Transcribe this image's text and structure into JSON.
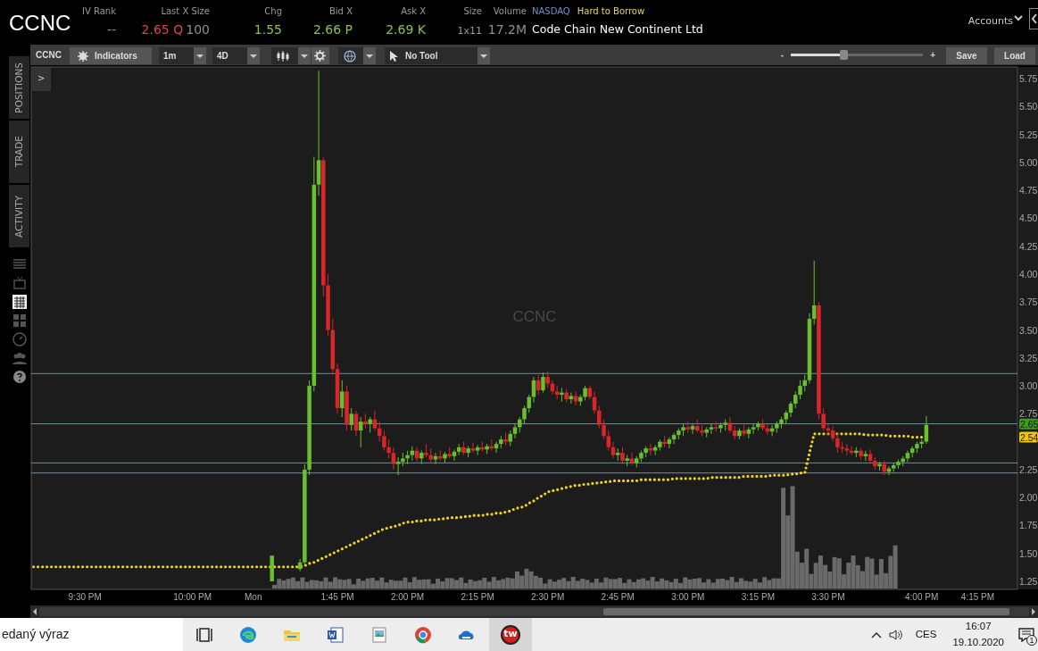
{
  "header": {
    "symbol": "CCNC",
    "quote_fields": [
      {
        "label": "IV Rank",
        "values": [
          {
            "text": "--",
            "color": "#8f8f8f",
            "kind": "normal"
          }
        ]
      },
      {
        "label": "Last X Size",
        "values": [
          {
            "text": "2.65 Q",
            "color": "#e0443c",
            "kind": "normal"
          },
          {
            "text": "100",
            "color": "#8f8f8f",
            "kind": "normal"
          }
        ]
      },
      {
        "label": "Chg",
        "values": [
          {
            "text": "1.55",
            "color": "#8cc152",
            "kind": "normal"
          }
        ]
      },
      {
        "label": "Bid X",
        "values": [
          {
            "text": "2.66 P",
            "color": "#8cc152",
            "kind": "normal"
          }
        ]
      },
      {
        "label": "Ask X",
        "values": [
          {
            "text": "2.69 K",
            "color": "#8cc152",
            "kind": "normal"
          }
        ]
      },
      {
        "label": "Size",
        "values": [
          {
            "text": "1x11",
            "color": "#9a9a9a",
            "kind": "small"
          }
        ]
      },
      {
        "label": "Volume",
        "values": [
          {
            "text": "17.2M",
            "color": "#8f8f8f",
            "kind": "normal"
          }
        ]
      }
    ],
    "exchange": "NASDAQ",
    "borrow_status": "Hard to Borrow",
    "company": "Code Chain New Continent Ltd",
    "accounts": "Accounts"
  },
  "sidebar": {
    "tabs": [
      {
        "label": "POSITIONS",
        "selected": false
      },
      {
        "label": "TRADE",
        "selected": false
      },
      {
        "label": "ACTIVITY",
        "selected": false
      }
    ],
    "icons": [
      {
        "kind": "list",
        "selected": false
      },
      {
        "kind": "tv",
        "selected": false
      },
      {
        "kind": "chart",
        "selected": true
      },
      {
        "kind": "grid",
        "selected": false
      },
      {
        "kind": "gauge",
        "selected": false
      },
      {
        "kind": "people",
        "selected": false
      },
      {
        "kind": "help",
        "selected": false
      }
    ]
  },
  "toolbar": {
    "symbol": "CCNC",
    "indicators": "Indicators",
    "interval": "1m",
    "range": "4D",
    "tool": "No Tool",
    "zoom": {
      "minus": "-",
      "plus": "+",
      "level": 0.4
    },
    "buttons": [
      "Save",
      "Load"
    ]
  },
  "chart": {
    "expand_button": ">",
    "symbol_label": "CCNC",
    "price_badges": [
      {
        "text": "2.65",
        "color": "#3f9a1e"
      },
      {
        "text": "2.54",
        "color": "#f2c40f"
      }
    ],
    "chart_data": {
      "type": "candlestick",
      "ylim": [
        1.178,
        5.854
      ],
      "yticks": [
        1.25,
        {
          "value": 1.5,
          "label": "1.50"
        },
        1.75,
        {
          "value": 2,
          "label": "2.00"
        },
        2.25,
        2.75,
        {
          "value": 3,
          "label": "3.00"
        },
        3.25,
        {
          "value": 3.5,
          "label": "3.50"
        },
        3.75,
        {
          "value": 4,
          "label": "4.00"
        },
        4.25,
        {
          "value": 4.5,
          "label": "4.50"
        },
        4.75,
        {
          "value": 5,
          "label": "5.00"
        },
        5.25,
        {
          "value": 5.5,
          "label": "5.50"
        },
        5.75
      ],
      "categories": [
        null,
        null,
        null,
        null,
        null,
        null,
        null,
        null,
        null,
        null,
        null,
        "9:30 PM",
        null,
        null,
        null,
        null,
        null,
        null,
        null,
        null,
        null,
        null,
        null,
        null,
        null,
        null,
        null,
        null,
        null,
        null,
        null,
        null,
        null,
        null,
        "10:00 PM",
        null,
        null,
        null,
        null,
        null,
        null,
        null,
        null,
        null,
        null,
        null,
        null,
        "Mon",
        null,
        null,
        null,
        null,
        null,
        null,
        null,
        null,
        null,
        null,
        null,
        null,
        null,
        null,
        null,
        null,
        null,
        "1:45 PM",
        null,
        null,
        null,
        null,
        null,
        null,
        null,
        null,
        null,
        null,
        null,
        null,
        null,
        null,
        "2:00 PM",
        null,
        null,
        null,
        null,
        null,
        null,
        null,
        null,
        null,
        null,
        null,
        null,
        null,
        null,
        "2:15 PM",
        null,
        null,
        null,
        null,
        null,
        null,
        null,
        null,
        null,
        null,
        null,
        null,
        null,
        null,
        "2:30 PM",
        null,
        null,
        null,
        null,
        null,
        null,
        null,
        null,
        null,
        null,
        null,
        null,
        null,
        null,
        "2:45 PM",
        null,
        null,
        null,
        null,
        null,
        null,
        null,
        null,
        null,
        null,
        null,
        null,
        null,
        null,
        "3:00 PM",
        null,
        null,
        null,
        null,
        null,
        null,
        null,
        null,
        null,
        null,
        null,
        null,
        null,
        null,
        "3:15 PM",
        null,
        null,
        null,
        null,
        null,
        null,
        null,
        null,
        null,
        null,
        null,
        null,
        null,
        null,
        "3:30 PM",
        null,
        null,
        null,
        null,
        null,
        null,
        null,
        null,
        null,
        null,
        null,
        null,
        null,
        null,
        null,
        null,
        null,
        null,
        null,
        "4:00 PM",
        null,
        null,
        null,
        null,
        null,
        null,
        null,
        null,
        null,
        null,
        null,
        "4:15 PM",
        null,
        null,
        null,
        null,
        null,
        null,
        null,
        null
      ],
      "ohlc": [
        null,
        null,
        null,
        null,
        null,
        null,
        null,
        null,
        null,
        null,
        null,
        null,
        null,
        null,
        null,
        null,
        null,
        null,
        null,
        null,
        null,
        null,
        null,
        null,
        null,
        null,
        null,
        null,
        null,
        null,
        null,
        null,
        null,
        null,
        null,
        null,
        null,
        null,
        null,
        null,
        null,
        null,
        null,
        null,
        null,
        null,
        null,
        null,
        null,
        null,
        null,
        [
          1.25,
          1.48,
          1.25,
          1.48
        ],
        null,
        null,
        null,
        null,
        null,
        [
          1.36,
          1.45,
          1.34,
          1.42
        ],
        [
          1.42,
          2.3,
          1.4,
          2.25
        ],
        [
          2.25,
          3.05,
          2.2,
          3.0
        ],
        [
          3.0,
          5.05,
          2.95,
          4.8
        ],
        [
          4.8,
          5.82,
          4.7,
          5.02
        ],
        [
          5.02,
          5.05,
          3.8,
          3.9
        ],
        [
          3.9,
          4.0,
          3.45,
          3.5
        ],
        [
          3.5,
          3.6,
          3.1,
          3.15
        ],
        [
          3.15,
          3.2,
          2.75,
          2.8
        ],
        [
          2.8,
          3.05,
          2.72,
          2.95
        ],
        [
          2.95,
          3.0,
          2.6,
          2.65
        ],
        [
          2.65,
          2.8,
          2.6,
          2.75
        ],
        [
          2.75,
          2.78,
          2.55,
          2.6
        ],
        [
          2.6,
          2.72,
          2.45,
          2.68
        ],
        [
          2.68,
          2.75,
          2.62,
          2.66
        ],
        [
          2.66,
          2.72,
          2.58,
          2.7
        ],
        [
          2.7,
          2.78,
          2.6,
          2.62
        ],
        [
          2.62,
          2.68,
          2.5,
          2.55
        ],
        [
          2.55,
          2.6,
          2.42,
          2.45
        ],
        [
          2.45,
          2.52,
          2.35,
          2.4
        ],
        [
          2.4,
          2.45,
          2.25,
          2.3
        ],
        [
          2.3,
          2.36,
          2.2,
          2.32
        ],
        [
          2.32,
          2.4,
          2.28,
          2.35
        ],
        [
          2.35,
          2.42,
          2.3,
          2.38
        ],
        [
          2.38,
          2.46,
          2.33,
          2.42
        ],
        [
          2.42,
          2.45,
          2.32,
          2.35
        ],
        [
          2.35,
          2.42,
          2.3,
          2.4
        ],
        [
          2.4,
          2.48,
          2.36,
          2.38
        ],
        [
          2.38,
          2.44,
          2.32,
          2.34
        ],
        [
          2.34,
          2.4,
          2.3,
          2.37
        ],
        [
          2.37,
          2.42,
          2.33,
          2.35
        ],
        [
          2.35,
          2.41,
          2.31,
          2.39
        ],
        [
          2.39,
          2.45,
          2.35,
          2.37
        ],
        [
          2.37,
          2.43,
          2.33,
          2.41
        ],
        [
          2.41,
          2.48,
          2.38,
          2.45
        ],
        [
          2.45,
          2.5,
          2.38,
          2.4
        ],
        [
          2.4,
          2.46,
          2.36,
          2.44
        ],
        [
          2.44,
          2.49,
          2.4,
          2.42
        ],
        [
          2.42,
          2.47,
          2.38,
          2.45
        ],
        [
          2.45,
          2.5,
          2.41,
          2.43
        ],
        [
          2.43,
          2.48,
          2.39,
          2.46
        ],
        [
          2.46,
          2.52,
          2.42,
          2.44
        ],
        [
          2.44,
          2.5,
          2.4,
          2.48
        ],
        [
          2.48,
          2.55,
          2.44,
          2.52
        ],
        [
          2.52,
          2.58,
          2.47,
          2.5
        ],
        [
          2.5,
          2.6,
          2.46,
          2.57
        ],
        [
          2.57,
          2.66,
          2.53,
          2.63
        ],
        [
          2.63,
          2.72,
          2.58,
          2.7
        ],
        [
          2.7,
          2.82,
          2.66,
          2.8
        ],
        [
          2.8,
          2.92,
          2.76,
          2.9
        ],
        [
          2.9,
          3.08,
          2.85,
          3.05
        ],
        [
          3.05,
          3.1,
          2.92,
          2.96
        ],
        [
          2.96,
          3.12,
          2.94,
          3.08
        ],
        [
          3.08,
          3.13,
          2.98,
          3.02
        ],
        [
          3.02,
          3.05,
          2.92,
          2.95
        ],
        [
          2.95,
          3.0,
          2.88,
          2.92
        ],
        [
          2.92,
          2.98,
          2.86,
          2.94
        ],
        [
          2.94,
          2.97,
          2.85,
          2.88
        ],
        [
          2.88,
          2.94,
          2.84,
          2.91
        ],
        [
          2.91,
          2.95,
          2.83,
          2.86
        ],
        [
          2.86,
          2.92,
          2.82,
          2.9
        ],
        [
          2.9,
          3.0,
          2.87,
          2.98
        ],
        [
          2.98,
          3.0,
          2.88,
          2.9
        ],
        [
          2.9,
          2.95,
          2.75,
          2.78
        ],
        [
          2.78,
          2.82,
          2.62,
          2.65
        ],
        [
          2.65,
          2.7,
          2.52,
          2.55
        ],
        [
          2.55,
          2.6,
          2.42,
          2.45
        ],
        [
          2.45,
          2.5,
          2.35,
          2.38
        ],
        [
          2.38,
          2.44,
          2.33,
          2.4
        ],
        [
          2.4,
          2.45,
          2.3,
          2.33
        ],
        [
          2.33,
          2.38,
          2.28,
          2.35
        ],
        [
          2.35,
          2.4,
          2.29,
          2.31
        ],
        [
          2.31,
          2.37,
          2.27,
          2.35
        ],
        [
          2.35,
          2.42,
          2.32,
          2.4
        ],
        [
          2.4,
          2.46,
          2.36,
          2.44
        ],
        [
          2.44,
          2.48,
          2.38,
          2.42
        ],
        [
          2.42,
          2.47,
          2.38,
          2.45
        ],
        [
          2.45,
          2.52,
          2.42,
          2.5
        ],
        [
          2.5,
          2.55,
          2.45,
          2.48
        ],
        [
          2.48,
          2.54,
          2.44,
          2.52
        ],
        [
          2.52,
          2.58,
          2.48,
          2.56
        ],
        [
          2.56,
          2.62,
          2.52,
          2.6
        ],
        [
          2.6,
          2.66,
          2.55,
          2.63
        ],
        [
          2.63,
          2.68,
          2.58,
          2.61
        ],
        [
          2.61,
          2.66,
          2.57,
          2.64
        ],
        [
          2.64,
          2.7,
          2.58,
          2.6
        ],
        [
          2.6,
          2.65,
          2.55,
          2.58
        ],
        [
          2.58,
          2.63,
          2.54,
          2.61
        ],
        [
          2.61,
          2.66,
          2.57,
          2.63
        ],
        [
          2.63,
          2.68,
          2.59,
          2.62
        ],
        [
          2.62,
          2.67,
          2.58,
          2.65
        ],
        [
          2.65,
          2.7,
          2.6,
          2.67
        ],
        [
          2.67,
          2.72,
          2.58,
          2.6
        ],
        [
          2.6,
          2.64,
          2.52,
          2.55
        ],
        [
          2.55,
          2.62,
          2.52,
          2.6
        ],
        [
          2.6,
          2.65,
          2.55,
          2.57
        ],
        [
          2.57,
          2.63,
          2.53,
          2.61
        ],
        [
          2.61,
          2.66,
          2.57,
          2.63
        ],
        [
          2.63,
          2.68,
          2.6,
          2.66
        ],
        [
          2.66,
          2.7,
          2.6,
          2.62
        ],
        [
          2.62,
          2.66,
          2.56,
          2.59
        ],
        [
          2.59,
          2.65,
          2.55,
          2.62
        ],
        [
          2.62,
          2.68,
          2.58,
          2.66
        ],
        [
          2.66,
          2.72,
          2.62,
          2.7
        ],
        [
          2.7,
          2.78,
          2.66,
          2.76
        ],
        [
          2.76,
          2.86,
          2.72,
          2.84
        ],
        [
          2.84,
          2.95,
          2.8,
          2.92
        ],
        [
          2.92,
          3.05,
          2.88,
          3.0
        ],
        [
          3.0,
          3.1,
          2.95,
          3.05
        ],
        [
          3.05,
          3.65,
          3.02,
          3.6
        ],
        [
          3.6,
          4.12,
          3.55,
          3.72
        ],
        [
          3.72,
          3.75,
          2.7,
          2.75
        ],
        [
          2.75,
          2.8,
          2.6,
          2.62
        ],
        [
          2.62,
          2.66,
          2.55,
          2.6
        ],
        [
          2.6,
          2.64,
          2.5,
          2.53
        ],
        [
          2.53,
          2.58,
          2.4,
          2.45
        ],
        [
          2.45,
          2.5,
          2.4,
          2.44
        ],
        [
          2.44,
          2.48,
          2.38,
          2.42
        ],
        [
          2.42,
          2.46,
          2.38,
          2.4
        ],
        [
          2.4,
          2.45,
          2.36,
          2.42
        ],
        [
          2.42,
          2.44,
          2.34,
          2.37
        ],
        [
          2.37,
          2.42,
          2.33,
          2.39
        ],
        [
          2.39,
          2.43,
          2.3,
          2.33
        ],
        [
          2.33,
          2.36,
          2.25,
          2.28
        ],
        [
          2.28,
          2.32,
          2.24,
          2.3
        ],
        [
          2.3,
          2.33,
          2.2,
          2.23
        ],
        [
          2.23,
          2.28,
          2.2,
          2.26
        ],
        [
          2.26,
          2.31,
          2.23,
          2.29
        ],
        [
          2.29,
          2.34,
          2.26,
          2.32
        ],
        [
          2.32,
          2.37,
          2.28,
          2.35
        ],
        [
          2.35,
          2.42,
          2.32,
          2.4
        ],
        [
          2.4,
          2.46,
          2.36,
          2.44
        ],
        [
          2.44,
          2.5,
          2.4,
          2.48
        ],
        [
          2.48,
          2.52,
          2.44,
          2.5
        ],
        [
          2.5,
          2.73,
          2.48,
          2.65
        ],
        null,
        null,
        null,
        null,
        null,
        null,
        null,
        null,
        null,
        null,
        null,
        null,
        null,
        null,
        null,
        null,
        null,
        null,
        null
      ],
      "series": [
        {
          "type": "line",
          "color": "#f2d51b",
          "line_style": "dotted",
          "values": [
            1.38,
            1.38,
            1.38,
            1.38,
            1.38,
            1.38,
            1.38,
            1.38,
            1.38,
            1.38,
            1.38,
            1.38,
            1.38,
            1.38,
            1.38,
            1.38,
            1.38,
            1.38,
            1.38,
            1.38,
            1.38,
            1.38,
            1.38,
            1.38,
            1.38,
            1.38,
            1.38,
            1.38,
            1.38,
            1.38,
            1.38,
            1.38,
            1.38,
            1.38,
            1.38,
            1.38,
            1.38,
            1.38,
            1.38,
            1.38,
            1.38,
            1.38,
            1.38,
            1.38,
            1.38,
            1.38,
            1.38,
            1.38,
            1.38,
            1.38,
            1.38,
            1.38,
            1.38,
            1.38,
            1.38,
            1.38,
            1.38,
            1.38,
            1.39,
            1.41,
            1.42,
            1.44,
            1.46,
            1.48,
            1.5,
            1.52,
            1.54,
            1.56,
            1.58,
            1.6,
            1.62,
            1.64,
            1.66,
            1.68,
            1.7,
            1.72,
            1.73,
            1.74,
            1.75,
            1.77,
            1.78,
            1.78,
            1.79,
            1.79,
            1.8,
            1.8,
            1.8,
            1.81,
            1.81,
            1.82,
            1.82,
            1.82,
            1.83,
            1.83,
            1.84,
            1.84,
            1.84,
            1.85,
            1.85,
            1.86,
            1.86,
            1.87,
            1.88,
            1.9,
            1.91,
            1.92,
            1.95,
            1.97,
            2.0,
            2.02,
            2.05,
            2.06,
            2.07,
            2.08,
            2.09,
            2.1,
            2.11,
            2.11,
            2.12,
            2.12,
            2.13,
            2.13,
            2.14,
            2.14,
            2.15,
            2.15,
            2.15,
            2.15,
            2.15,
            2.15,
            2.16,
            2.16,
            2.16,
            2.16,
            2.16,
            2.16,
            2.16,
            2.17,
            2.17,
            2.17,
            2.17,
            2.17,
            2.17,
            2.17,
            2.17,
            2.18,
            2.18,
            2.18,
            2.18,
            2.18,
            2.18,
            2.18,
            2.19,
            2.19,
            2.19,
            2.19,
            2.19,
            2.19,
            2.2,
            2.2,
            2.2,
            2.2,
            2.21,
            2.21,
            2.22,
            2.22,
            2.4,
            2.57,
            2.57,
            2.57,
            2.57,
            2.57,
            2.57,
            2.57,
            2.57,
            2.57,
            2.57,
            2.57,
            2.56,
            2.56,
            2.56,
            2.56,
            2.56,
            2.55,
            2.55,
            2.55,
            2.55,
            2.55,
            2.54,
            2.54,
            2.54,
            2.54,
            null,
            null,
            null,
            null,
            null,
            null,
            null,
            null,
            null,
            null,
            null,
            null,
            null,
            null,
            null,
            null,
            null,
            null,
            null
          ]
        }
      ],
      "ref_lines": [
        {
          "axis": "y",
          "value": 3.11,
          "color": "#6f8f9c"
        },
        {
          "axis": "y",
          "value": 2.66,
          "color": "#6f8f9c"
        },
        {
          "axis": "y",
          "value": 2.31,
          "color": "#6f8f9c"
        },
        {
          "axis": "y",
          "value": 2.22,
          "color": "#6f8f9c"
        }
      ]
    }
  },
  "taskbar": {
    "search_text": "edaný výraz",
    "apps": [
      {
        "kind": "task-view",
        "selected": false
      },
      {
        "kind": "swirl",
        "selected": false
      },
      {
        "kind": "folder",
        "selected": false
      },
      {
        "kind": "document",
        "selected": false
      },
      {
        "kind": "image",
        "selected": false
      },
      {
        "kind": "round",
        "selected": false
      },
      {
        "kind": "cloud",
        "selected": false
      },
      {
        "kind": "tw",
        "label": "tw",
        "selected": true
      }
    ],
    "tray": {
      "language": "CES",
      "time": "16:07",
      "date": "19.10.2020",
      "notifications": "1"
    }
  }
}
